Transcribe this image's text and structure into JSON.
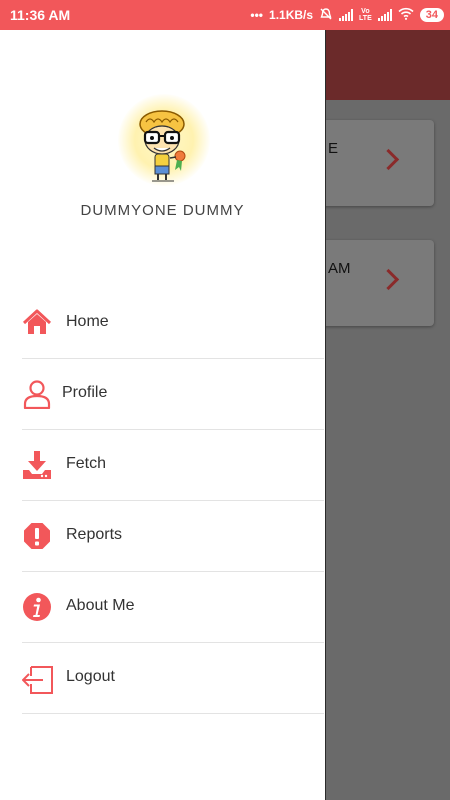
{
  "status_bar": {
    "time": "11:36 AM",
    "network_speed": "1.1KB/s",
    "battery": "34",
    "icons": [
      "more-icon",
      "mute-icon",
      "signal-icon",
      "volte-icon",
      "wifi-icon",
      "battery-icon"
    ]
  },
  "drawer": {
    "user_name": "DUMMYONE  DUMMY",
    "menu": [
      {
        "label": "Home",
        "icon": "home-icon"
      },
      {
        "label": "Profile",
        "icon": "user-icon"
      },
      {
        "label": "Fetch",
        "icon": "download-icon"
      },
      {
        "label": "Reports",
        "icon": "alert-icon"
      },
      {
        "label": "About Me",
        "icon": "info-icon"
      },
      {
        "label": "Logout",
        "icon": "logout-icon"
      }
    ]
  },
  "background": {
    "cards": [
      {
        "text": "E"
      },
      {
        "text": "AM"
      }
    ]
  },
  "colors": {
    "accent": "#f2575a",
    "appbar_dim": "#6b2a2a",
    "scrim": "#6a6a6a"
  }
}
